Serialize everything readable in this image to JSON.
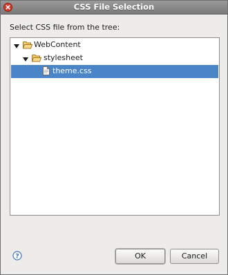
{
  "window": {
    "title": "CSS File Selection"
  },
  "instruction": "Select CSS file from the tree:",
  "tree": {
    "items": [
      {
        "label": "WebContent",
        "type": "folder",
        "expanded": true
      },
      {
        "label": "stylesheet",
        "type": "folder",
        "expanded": true
      },
      {
        "label": "theme.css",
        "type": "file",
        "selected": true
      }
    ]
  },
  "buttons": {
    "ok_label": "OK",
    "cancel_label": "Cancel"
  },
  "icons": {
    "close": "close-icon",
    "help": "help-icon",
    "folder": "folder-open-icon",
    "file": "css-file-icon",
    "expand": "triangle-down-icon"
  },
  "colors": {
    "selection": "#4a86c7",
    "titlebar": "#8a8a8a",
    "close_button": "#d43c2a",
    "folder": "#e8b04a",
    "help": "#3b73b9"
  }
}
